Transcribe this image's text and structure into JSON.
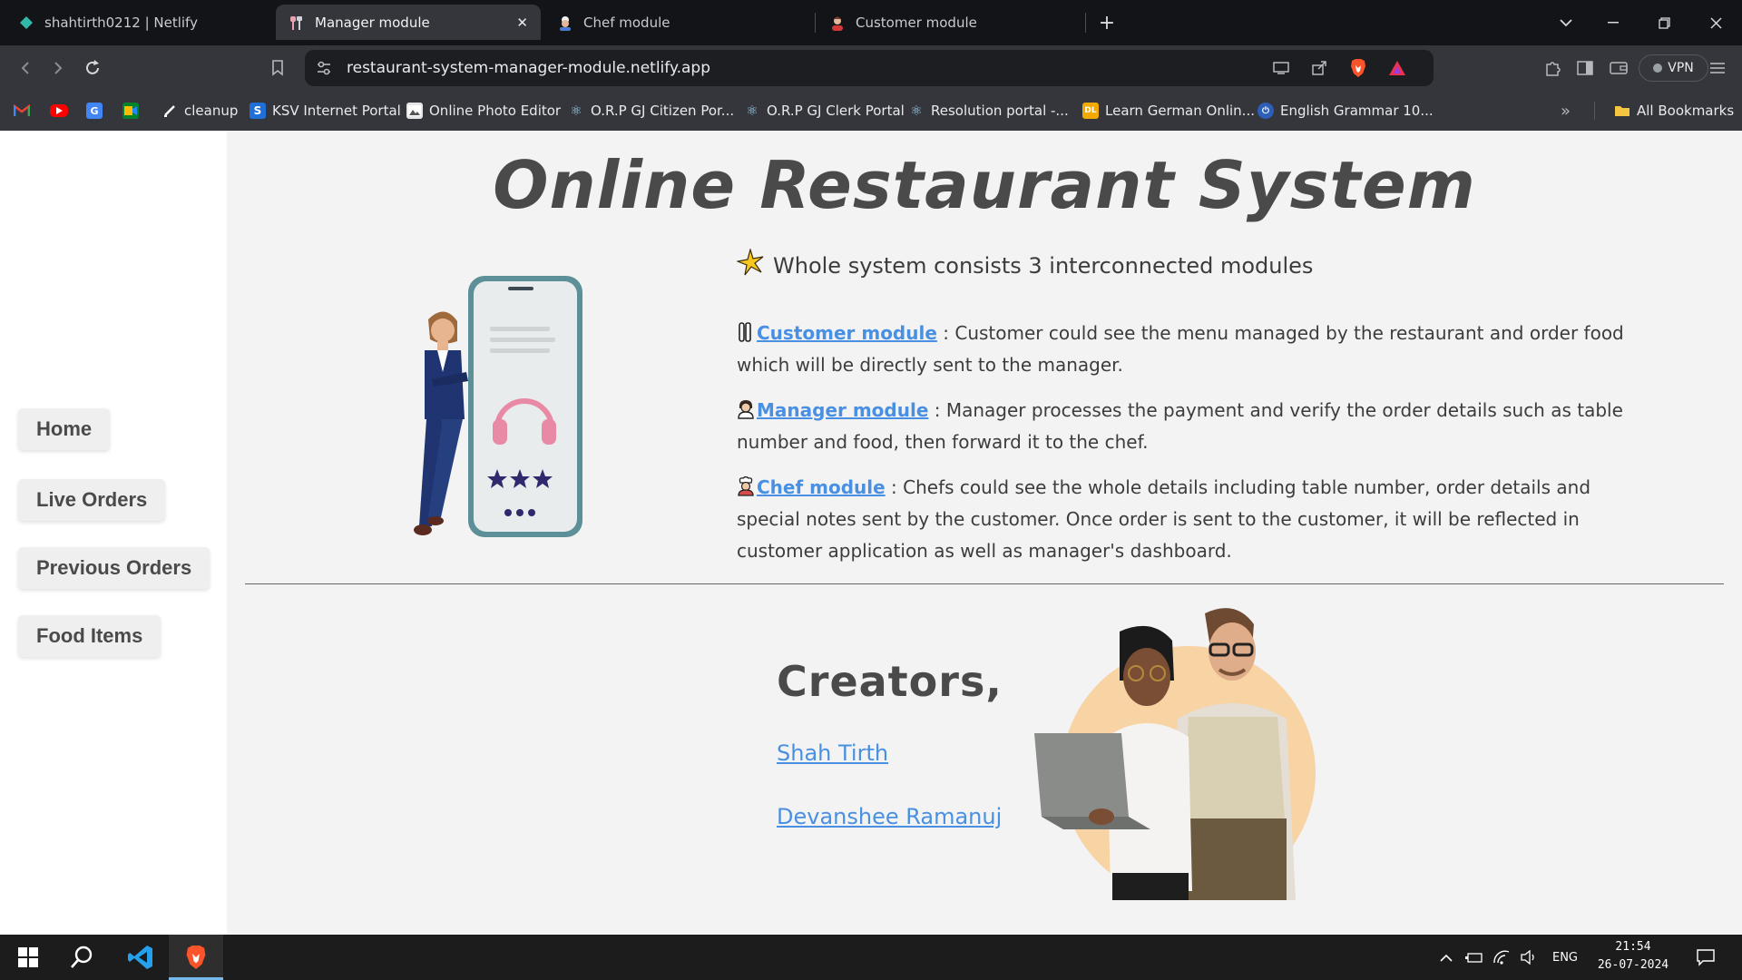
{
  "browser": {
    "tabs": [
      {
        "title": "shahtirth0212 | Netlify",
        "icon": "netlify-icon",
        "active": false
      },
      {
        "title": "Manager module",
        "icon": "restaurant-icon",
        "active": true
      },
      {
        "title": "Chef module",
        "icon": "chef-icon",
        "active": false
      },
      {
        "title": "Customer module",
        "icon": "customer-icon",
        "active": false
      }
    ],
    "url": "restaurant-system-manager-module.netlify.app",
    "vpn_label": "VPN",
    "bookmarks": [
      {
        "label": "",
        "icon": "gmail-icon"
      },
      {
        "label": "",
        "icon": "youtube-icon"
      },
      {
        "label": "",
        "icon": "translate-icon"
      },
      {
        "label": "",
        "icon": "meet-icon"
      },
      {
        "label": "cleanup",
        "icon": "brush-icon"
      },
      {
        "label": "KSV Internet Portal",
        "icon": "ksv-icon"
      },
      {
        "label": "Online Photo Editor",
        "icon": "photo-icon"
      },
      {
        "label": "O.R.P GJ Citizen Por...",
        "icon": "react-icon"
      },
      {
        "label": "O.R.P GJ Clerk Portal",
        "icon": "react-icon"
      },
      {
        "label": "Resolution portal -...",
        "icon": "react-icon"
      },
      {
        "label": "Learn German Onlin...",
        "icon": "dl-icon"
      },
      {
        "label": "English Grammar 10...",
        "icon": "grammar-icon"
      }
    ],
    "all_bookmarks": "All Bookmarks"
  },
  "sidebar": {
    "items": [
      {
        "label": "Home"
      },
      {
        "label": "Live Orders"
      },
      {
        "label": "Previous Orders"
      },
      {
        "label": "Food Items"
      }
    ]
  },
  "main": {
    "title": "Online Restaurant System",
    "intro": "Whole system consists 3 interconnected modules",
    "modules": [
      {
        "link": "Customer module",
        "text": " : Customer could see the menu managed by the restaurant and order food which will be directly sent to the manager.",
        "icon": "fork-spoon-icon"
      },
      {
        "link": "Manager module",
        "text": " : Manager processes the payment and verify the order details such as table number and food, then forward it to the chef.",
        "icon": "manager-icon"
      },
      {
        "link": "Chef module",
        "text": " : Chefs could see the whole details including table number, order details and special notes sent by the customer. Once order is sent to the customer, it will be reflected in customer application as well as manager's dashboard.",
        "icon": "chef-icon"
      }
    ],
    "creators_title": "Creators,",
    "creators": [
      "Shah Tirth",
      "Devanshee Ramanuj"
    ]
  },
  "taskbar": {
    "language": "ENG",
    "time": "21:54",
    "date": "26-07-2024"
  }
}
